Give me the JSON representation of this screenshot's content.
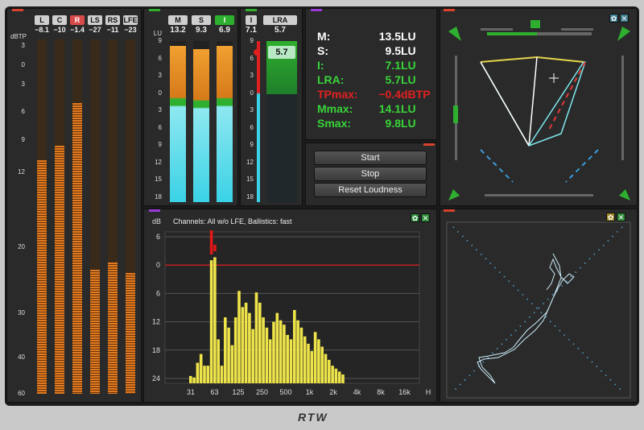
{
  "peak_meter": {
    "scale_label": "dBTP",
    "channels": [
      {
        "label": "L",
        "value": "−8.1",
        "level": 0.66,
        "highlight": false
      },
      {
        "label": "C",
        "value": "−10",
        "level": 0.7,
        "highlight": false
      },
      {
        "label": "R",
        "value": "−1.4",
        "level": 0.82,
        "highlight": true
      },
      {
        "label": "LS",
        "value": "−27",
        "level": 0.35,
        "highlight": false
      },
      {
        "label": "RS",
        "value": "−11",
        "level": 0.37,
        "highlight": false
      },
      {
        "label": "LFE",
        "value": "−23",
        "level": 0.34,
        "highlight": false
      }
    ],
    "scale": [
      "3",
      "0",
      "3",
      "6",
      "9",
      "12",
      "20",
      "30",
      "40",
      "60"
    ]
  },
  "loudness_bars": {
    "unit_label": "LU",
    "bars": [
      {
        "label": "M",
        "value": "13.2",
        "active": false,
        "level": 0.97
      },
      {
        "label": "S",
        "value": "9.3",
        "active": false,
        "level": 0.95
      },
      {
        "label": "I",
        "value": "6.9",
        "active": true,
        "level": 0.97
      }
    ],
    "scale": [
      "9",
      "6",
      "3",
      "0",
      "3",
      "6",
      "9",
      "12",
      "15",
      "18"
    ]
  },
  "lra_bar": {
    "i_label": "I",
    "i_value": "7.1",
    "lra_label": "LRA",
    "lra_value": "5.7",
    "marker_value": "5.7",
    "scale": [
      "9",
      "6",
      "3",
      "0",
      "3",
      "6",
      "9",
      "12",
      "15",
      "18"
    ]
  },
  "readouts": [
    {
      "label": "M:",
      "value": "13.5",
      "unit": "LU",
      "color": "#ffffff"
    },
    {
      "label": "S:",
      "value": "9.5",
      "unit": "LU",
      "color": "#ffffff"
    },
    {
      "label": "I:",
      "value": "7.1",
      "unit": "LU",
      "color": "#39d439"
    },
    {
      "label": "LRA:",
      "value": "5.7",
      "unit": "LU",
      "color": "#39d439"
    },
    {
      "label": "TPmax:",
      "value": "−0.4",
      "unit": "dBTP",
      "color": "#e02020"
    },
    {
      "label": "Mmax:",
      "value": "14.1",
      "unit": "LU",
      "color": "#39d439"
    },
    {
      "label": "Smax:",
      "value": "9.8",
      "unit": "LU",
      "color": "#39d439"
    }
  ],
  "controls": {
    "start_label": "Start",
    "stop_label": "Stop",
    "reset_label": "Reset Loudness"
  },
  "spectrum": {
    "ylabel": "dB",
    "title": "Channels: All w/o LFE, Ballistics: fast",
    "y_ticks": [
      "6",
      "0",
      "6",
      "12",
      "18",
      "24"
    ],
    "x_ticks": [
      "31",
      "63",
      "125",
      "250",
      "500",
      "1k",
      "2k",
      "4k",
      "8k",
      "16k",
      "H"
    ]
  },
  "chart_data": {
    "type": "bar",
    "title": "Channels: All w/o LFE, Ballistics: fast",
    "ylabel": "dB",
    "y_range_top_to_bottom": [
      6,
      0,
      6,
      12,
      18,
      24
    ],
    "x_tick_labels": [
      "31",
      "63",
      "125",
      "250",
      "500",
      "1k",
      "2k",
      "4k",
      "8k",
      "16k"
    ],
    "band_levels_fraction": [
      0.05,
      0.04,
      0.14,
      0.2,
      0.12,
      0.12,
      0.84,
      0.86,
      0.3,
      0.12,
      0.45,
      0.38,
      0.26,
      0.45,
      0.63,
      0.52,
      0.55,
      0.48,
      0.37,
      0.62,
      0.55,
      0.45,
      0.38,
      0.3,
      0.42,
      0.48,
      0.43,
      0.4,
      0.33,
      0.3,
      0.5,
      0.43,
      0.38,
      0.32,
      0.27,
      0.22,
      0.35,
      0.3,
      0.25,
      0.2,
      0.16,
      0.12,
      0.1,
      0.08,
      0.06
    ]
  }
}
